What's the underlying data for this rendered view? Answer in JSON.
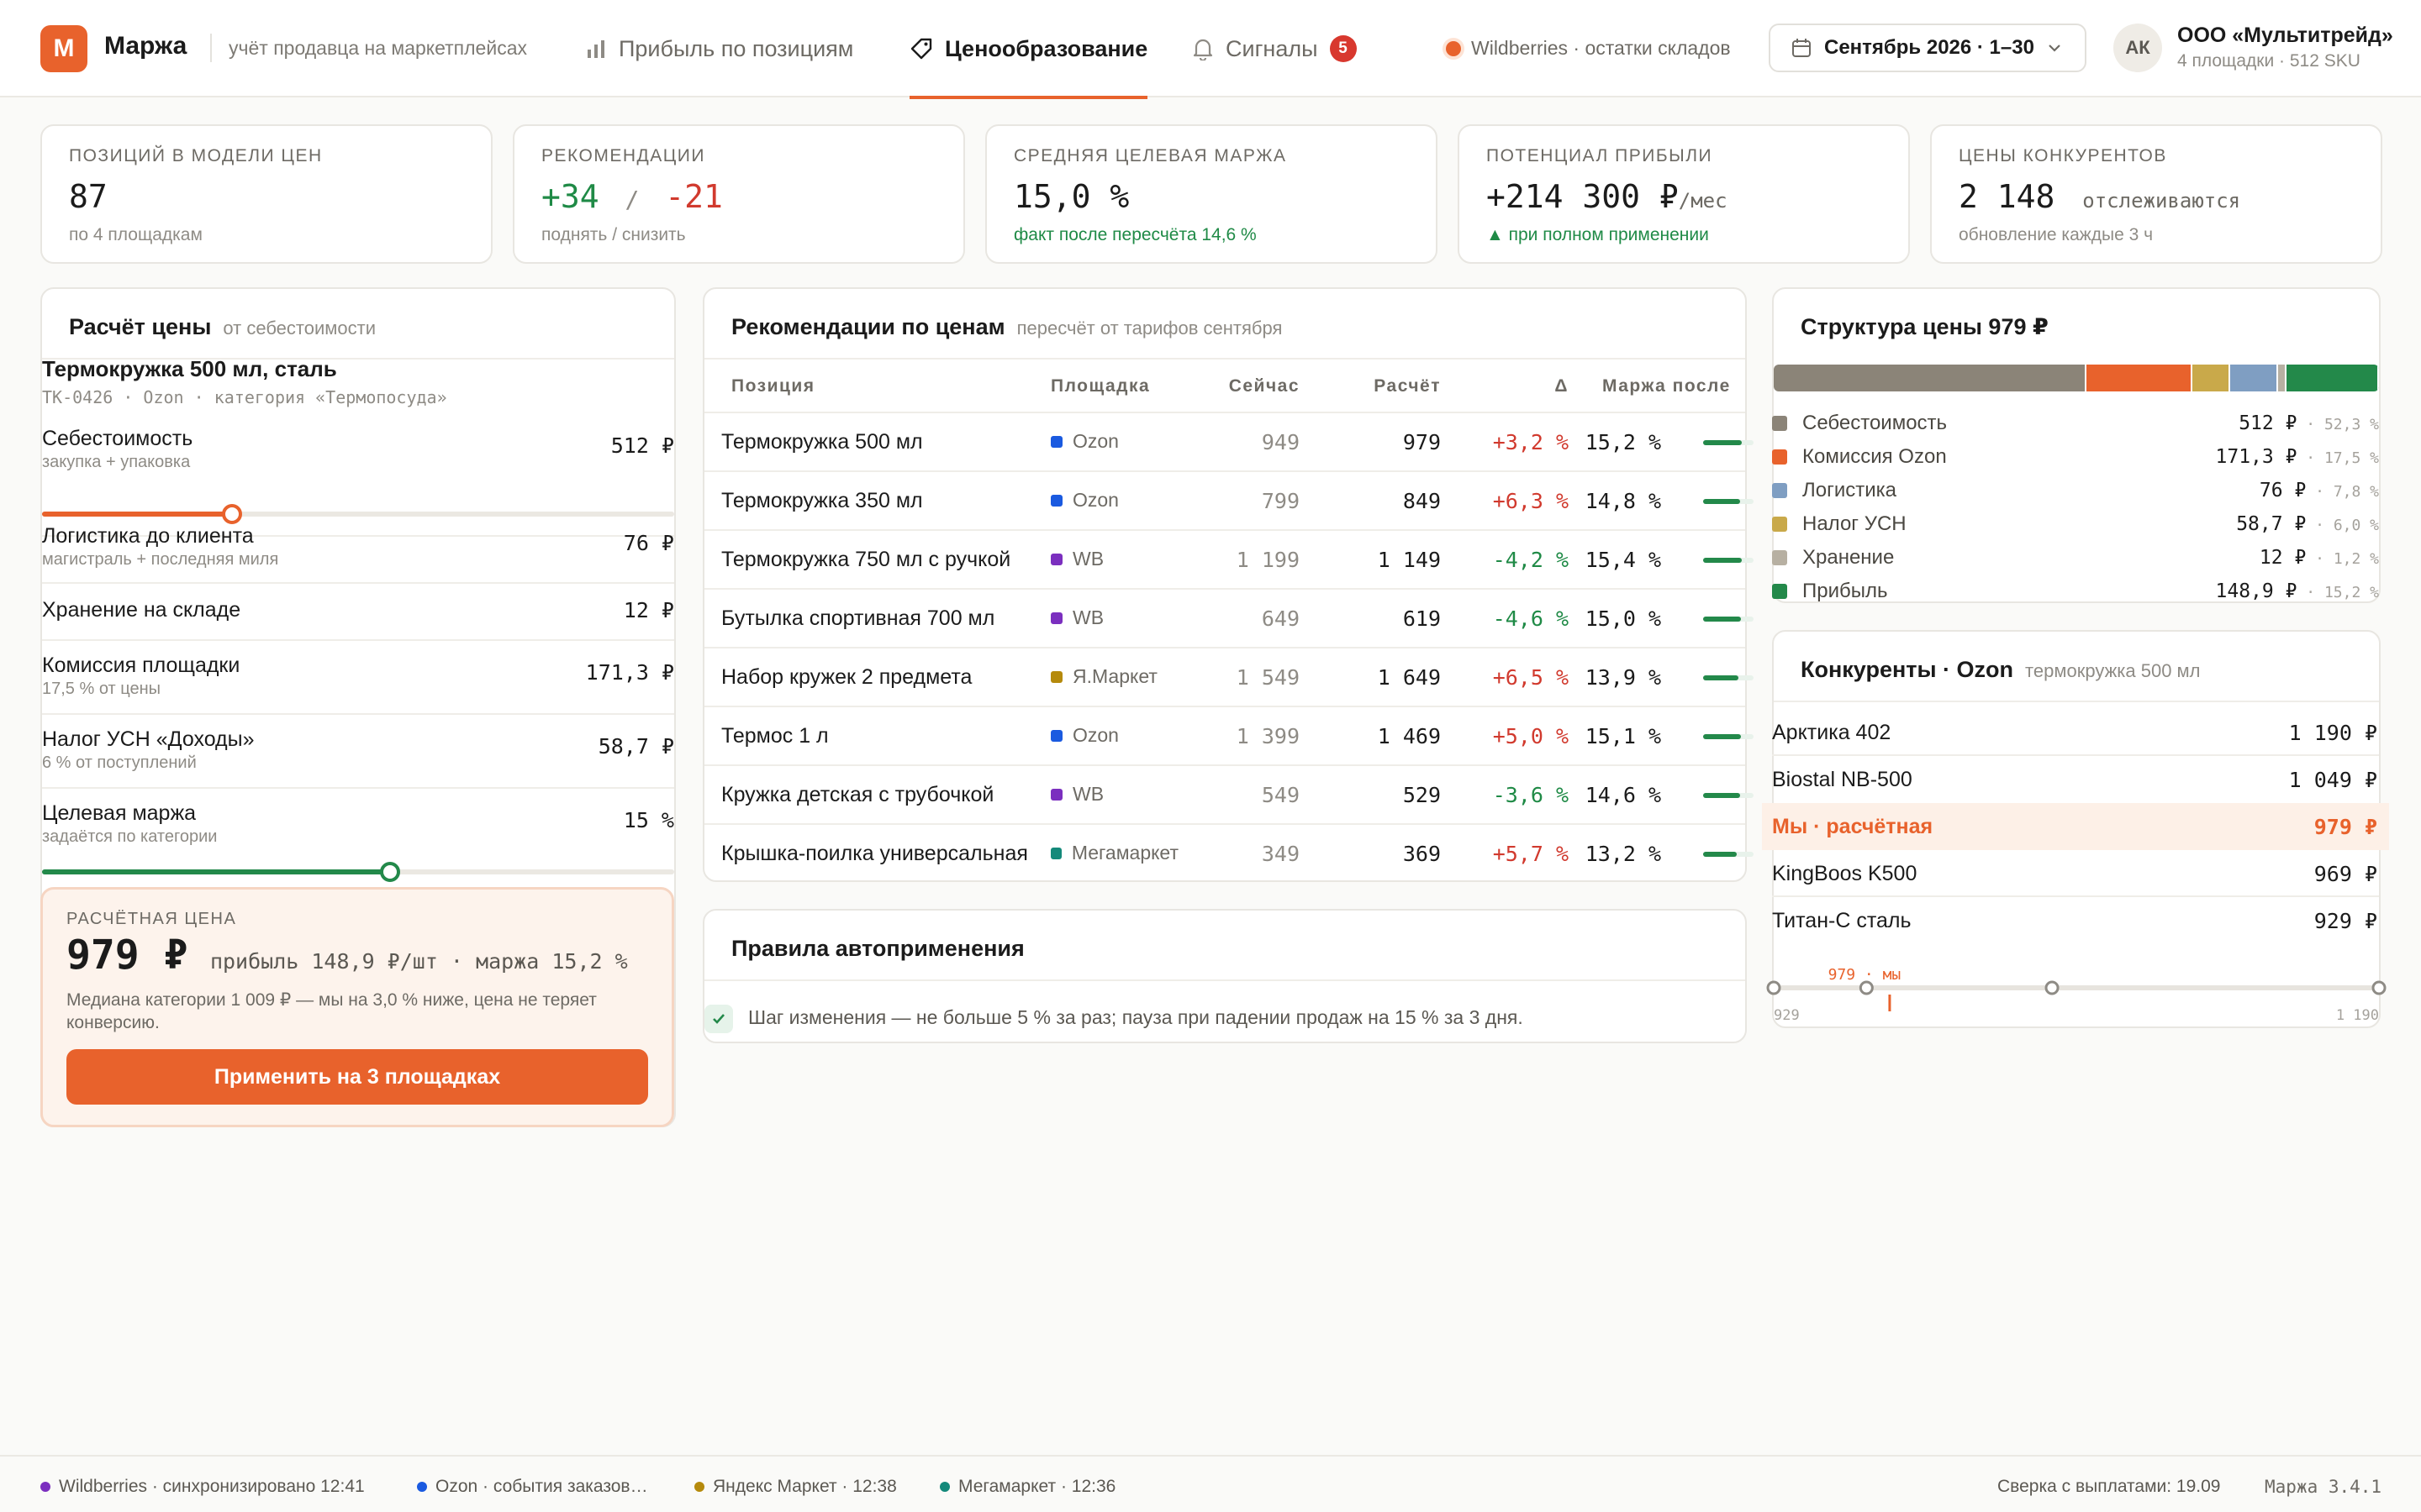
{
  "app": {
    "logo_letter": "М",
    "name": "Маржа",
    "subtitle": "учёт продавца на маркетплейсах",
    "accent": "#e8622c"
  },
  "nav": {
    "tabs": [
      {
        "label": "Прибыль по позициям",
        "icon": "bar-chart-icon"
      },
      {
        "label": "Ценообразование",
        "icon": "price-tag-icon"
      },
      {
        "label": "Сигналы",
        "icon": "bell-icon",
        "badge": "5"
      }
    ]
  },
  "header": {
    "source_status": "Wildberries · остатки складов",
    "period": "Сентябрь 2026 · 1–30",
    "avatar_initials": "АК",
    "company_name": "ООО «Мультитрейд»",
    "company_meta": "4 площадки · 512 SKU"
  },
  "kpis": [
    {
      "label": "Позиций в модели цен",
      "value": "87",
      "note": "по 4 площадкам"
    },
    {
      "label": "Рекомендации",
      "value_up": "+34",
      "separator": "/",
      "value_down": "-21",
      "note": "поднять / снизить"
    },
    {
      "label": "Средняя целевая маржа",
      "value": "15,0 %",
      "note": "факт после пересчёта 14,6 %"
    },
    {
      "label": "Потенциал прибыли",
      "value": "+214 300 ₽",
      "suffix": "/мес",
      "note": "▲ при полном применении"
    },
    {
      "label": "Цены конкурентов",
      "value": "2 148",
      "suffix": "отслеживаются",
      "note": "обновление каждые 3 ч"
    }
  ],
  "calc": {
    "title": "Расчёт цены",
    "subtitle": "от себестоимости",
    "product": "Термокружка 500 мл, сталь",
    "product_meta": "ТК-0426 · Ozon · категория «Термопосуда»",
    "rows": [
      {
        "name": "Себестоимость",
        "hint": "закупка + упаковка",
        "value": "512 ₽",
        "slider": 0.3
      },
      {
        "name": "Логистика до клиента",
        "hint": "магистраль + последняя миля",
        "value": "76 ₽"
      },
      {
        "name": "Хранение на складе",
        "hint": "",
        "value": "12 ₽"
      },
      {
        "name": "Комиссия площадки",
        "hint": "17,5 % от цены",
        "value": "171,3 ₽"
      },
      {
        "name": "Налог УСН «Доходы»",
        "hint": "6 % от поступлений",
        "value": "58,7 ₽"
      },
      {
        "name": "Целевая маржа",
        "hint": "задаётся по категории",
        "value": "15 %",
        "slider": 0.55
      }
    ],
    "result_label": "Расчётная цена",
    "result_price": "979 ₽",
    "result_meta": "прибыль 148,9 ₽/шт · маржа 15,2 %",
    "result_note": "Медиана категории 1 009 ₽ — мы на 3,0 % ниже, цена не теряет конверсию.",
    "apply_label": "Применить на 3 площадках"
  },
  "recs": {
    "title": "Рекомендации по ценам",
    "subtitle": "пересчёт от тарифов сентября",
    "columns": [
      "Позиция",
      "Площадка",
      "Сейчас",
      "Расчёт",
      "Δ",
      "Маржа после"
    ],
    "rows": [
      {
        "name": "Термокружка 500 мл",
        "platform": "Ozon",
        "now": "949",
        "calc": "979",
        "delta": "+3,2 %",
        "dir": "up",
        "margin": "15,2 %",
        "margin_frac": 0.76
      },
      {
        "name": "Термокружка 350 мл",
        "platform": "Ozon",
        "now": "799",
        "calc": "849",
        "delta": "+6,3 %",
        "dir": "up",
        "margin": "14,8 %",
        "margin_frac": 0.74
      },
      {
        "name": "Термокружка 750 мл с ручкой",
        "platform": "WB",
        "now": "1 199",
        "calc": "1 149",
        "delta": "-4,2 %",
        "dir": "down",
        "margin": "15,4 %",
        "margin_frac": 0.77
      },
      {
        "name": "Бутылка спортивная 700 мл",
        "platform": "WB",
        "now": "649",
        "calc": "619",
        "delta": "-4,6 %",
        "dir": "down",
        "margin": "15,0 %",
        "margin_frac": 0.75
      },
      {
        "name": "Набор кружек 2 предмета",
        "platform": "Я.Маркет",
        "now": "1 549",
        "calc": "1 649",
        "delta": "+6,5 %",
        "dir": "up",
        "margin": "13,9 %",
        "margin_frac": 0.7
      },
      {
        "name": "Термос 1 л",
        "platform": "Ozon",
        "now": "1 399",
        "calc": "1 469",
        "delta": "+5,0 %",
        "dir": "up",
        "margin": "15,1 %",
        "margin_frac": 0.75
      },
      {
        "name": "Кружка детская с трубочкой",
        "platform": "WB",
        "now": "549",
        "calc": "529",
        "delta": "-3,6 %",
        "dir": "down",
        "margin": "14,6 %",
        "margin_frac": 0.73
      },
      {
        "name": "Крышка-поилка универсальная",
        "platform": "Мегамаркет",
        "now": "349",
        "calc": "369",
        "delta": "+5,7 %",
        "dir": "up",
        "margin": "13,2 %",
        "margin_frac": 0.66
      }
    ]
  },
  "platform_colors": {
    "Ozon": "#1a5ae0",
    "WB": "#7b2fbf",
    "Я.Маркет": "#b58a0c",
    "Мегамаркет": "#14897a"
  },
  "rules": {
    "title": "Правила автоприменения",
    "items": [
      "Шаг изменения — не больше 5 % за раз; пауза при падении продаж на 15 % за 3 дня."
    ]
  },
  "structure": {
    "title": "Структура цены 979 ₽",
    "items": [
      {
        "name": "Себестоимость",
        "value": "512 ₽",
        "pct": "52,3 %",
        "share": 52.3,
        "color": "#8b8478"
      },
      {
        "name": "Комиссия Ozon",
        "value": "171,3 ₽",
        "pct": "17,5 %",
        "share": 17.5,
        "color": "#e8622c"
      },
      {
        "name": "Налог УСН",
        "value": "58,7 ₽",
        "pct": "6,0 %",
        "share": 6.0,
        "color": "#c9a94a"
      },
      {
        "name": "Логистика",
        "value": "76 ₽",
        "pct": "7,8 %",
        "share": 7.8,
        "color": "#7f9ec2"
      },
      {
        "name": "Хранение",
        "value": "12 ₽",
        "pct": "1,2 %",
        "share": 1.2,
        "color": "#b7b0a2"
      },
      {
        "name": "Прибыль",
        "value": "148,9 ₽",
        "pct": "15,2 %",
        "share": 15.2,
        "color": "#23894a"
      }
    ],
    "legend_order": [
      0,
      1,
      3,
      2,
      4,
      5
    ]
  },
  "competitors": {
    "title": "Конкуренты · Ozon",
    "subtitle": "термокружка 500 мл",
    "rows": [
      {
        "name": "Арктика 402",
        "price": "1 190 ₽"
      },
      {
        "name": "Biostal NB-500",
        "price": "1 049 ₽"
      },
      {
        "name": "Мы · расчётная",
        "price": "979 ₽",
        "ours": true
      },
      {
        "name": "KingBoos K500",
        "price": "969 ₽"
      },
      {
        "name": "Титан-С сталь",
        "price": "929 ₽"
      }
    ],
    "scale_min": "929",
    "scale_max": "1 190",
    "scale_marker": "979 · мы",
    "scale_points": [
      929,
      969,
      979,
      1049,
      1190
    ],
    "scale_range": [
      929,
      1190
    ],
    "our_value": 979
  },
  "footer": {
    "sources": [
      {
        "label": "Wildberries · синхронизировано 12:41",
        "color": "#7b2fbf"
      },
      {
        "label": "Ozon · события заказов…",
        "color": "#1a5ae0"
      },
      {
        "label": "Яндекс Маркет · 12:38",
        "color": "#b58a0c"
      },
      {
        "label": "Мегамаркет · 12:36",
        "color": "#14897a"
      }
    ],
    "reconcile": "Сверка с выплатами: 19.09",
    "version": "Маржа 3.4.1"
  }
}
